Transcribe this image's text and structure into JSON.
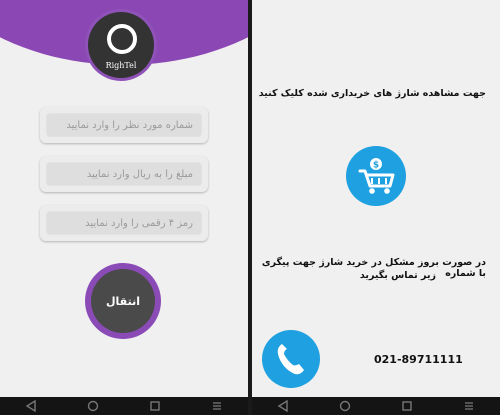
{
  "left_screen": {
    "logo_text": "RighTel",
    "fields": [
      {
        "placeholder": "شماره مورد نظر را وارد نمایید"
      },
      {
        "placeholder": "مبلغ را به ریال وارد نمایید"
      },
      {
        "placeholder": "رمز ۴ رقمی را وارد نمایید"
      }
    ],
    "transfer_label": "انتقال"
  },
  "right_screen": {
    "view_charges_text": "جهت مشاهده شارژ های خریداری شده کلیک کنید",
    "problem_text_line1": "در صورت بروز مشکل در خرید شارژ جهت پیگری با شماره",
    "problem_text_line2": "زیر تماس بگیرید",
    "support_phone": "021-89711111"
  },
  "icons": {
    "logo": "circle-logo-icon",
    "cart": "shopping-cart-icon",
    "phone": "phone-icon",
    "nav_back": "back-icon",
    "nav_home": "home-icon",
    "nav_recent": "recent-apps-icon",
    "nav_menu": "menu-icon"
  },
  "colors": {
    "accent_purple": "#8b48b5",
    "accent_blue": "#1fa0e0",
    "background": "#f0f0f0"
  }
}
